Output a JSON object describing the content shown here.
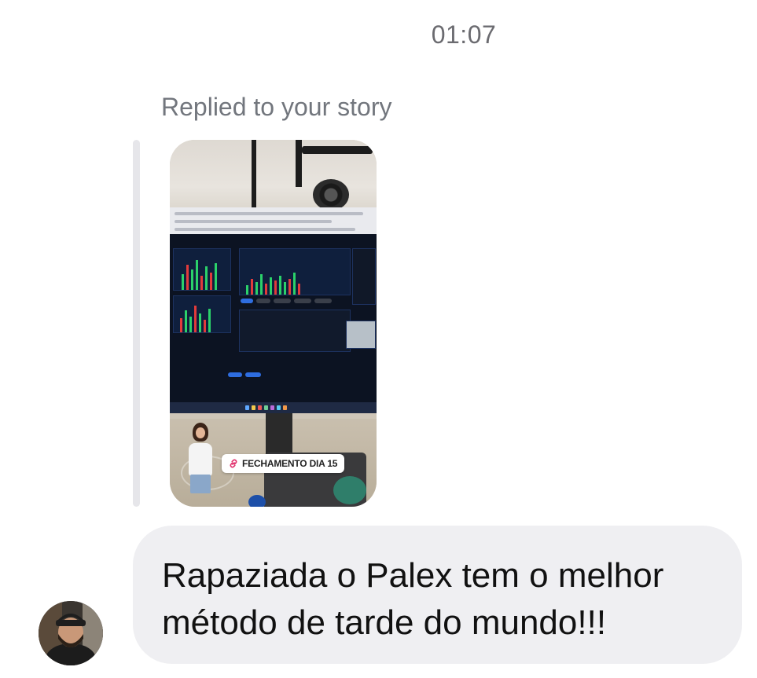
{
  "chat": {
    "timestamp": "01:07",
    "story_reply": {
      "label": "Replied to your story",
      "link_sticker": "FECHAMENTO DIA 15"
    },
    "message": {
      "text": "Rapaziada o Palex tem o melhor método de tarde do mundo!!!"
    }
  },
  "colors": {
    "bubble": "#efeff2",
    "rail": "#e6e6ea",
    "secondary_text": "#72767d"
  },
  "icons": [
    "link-icon",
    "avatar"
  ]
}
